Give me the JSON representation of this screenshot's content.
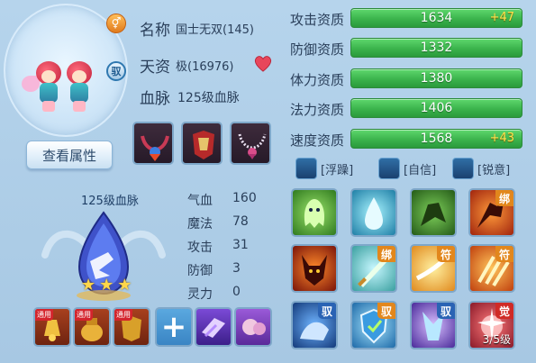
{
  "pet": {
    "name_label": "名称",
    "name_value": "国士无双(145)",
    "talent_label": "天资",
    "talent_value": "极(16976)",
    "bloodline_label": "血脉",
    "bloodline_value": "125级血脉",
    "gender_icon": "gender-icon",
    "bind_badge": "驭"
  },
  "buttons": {
    "view_attributes": "查看属性"
  },
  "equipment": [
    {
      "icon": "necklace-flame-icon"
    },
    {
      "icon": "armor-red-icon"
    },
    {
      "icon": "necklace-pearl-icon"
    }
  ],
  "bloodline": {
    "title": "125级血脉",
    "stars": 3,
    "stats": [
      {
        "label": "气血",
        "value": "160"
      },
      {
        "label": "魔法",
        "value": "78"
      },
      {
        "label": "攻击",
        "value": "31"
      },
      {
        "label": "防御",
        "value": "3"
      },
      {
        "label": "灵力",
        "value": "0"
      }
    ]
  },
  "items": [
    {
      "tag": "通用",
      "icon": "bell-gold-icon"
    },
    {
      "tag": "通用",
      "icon": "urn-gold-icon"
    },
    {
      "tag": "通用",
      "icon": "armor-gold-icon"
    },
    {
      "icon": "crystal-purple-icon"
    },
    {
      "icon": "fist-purple-icon"
    }
  ],
  "aptitudes": [
    {
      "label": "攻击资质",
      "value": "1634",
      "bonus": "+47"
    },
    {
      "label": "防御资质",
      "value": "1332",
      "bonus": ""
    },
    {
      "label": "体力资质",
      "value": "1380",
      "bonus": ""
    },
    {
      "label": "法力资质",
      "value": "1406",
      "bonus": ""
    },
    {
      "label": "速度资质",
      "value": "1568",
      "bonus": "+43"
    }
  ],
  "traits": [
    {
      "name": "[浮躁]"
    },
    {
      "name": "[自信]"
    },
    {
      "name": "[锐意]"
    }
  ],
  "skills": [
    {
      "icon": "ghost-green-icon",
      "corner": ""
    },
    {
      "icon": "water-blue-icon",
      "corner": ""
    },
    {
      "icon": "shadow-green-icon",
      "corner": ""
    },
    {
      "icon": "strike-red-icon",
      "corner": "绑"
    },
    {
      "icon": "demon-horn-icon",
      "corner": ""
    },
    {
      "icon": "sword-green-icon",
      "corner": "绑"
    },
    {
      "icon": "slash-orange-icon",
      "corner": "符"
    },
    {
      "icon": "claw-orange-icon",
      "corner": "符"
    },
    {
      "icon": "beast-blue-icon",
      "corner": "驭"
    },
    {
      "icon": "shield-blue-icon",
      "corner": "驭"
    },
    {
      "icon": "crystal-blue-icon",
      "corner": "驭"
    },
    {
      "icon": "burst-red-icon",
      "corner": "觉",
      "level": "3/5级"
    }
  ]
}
